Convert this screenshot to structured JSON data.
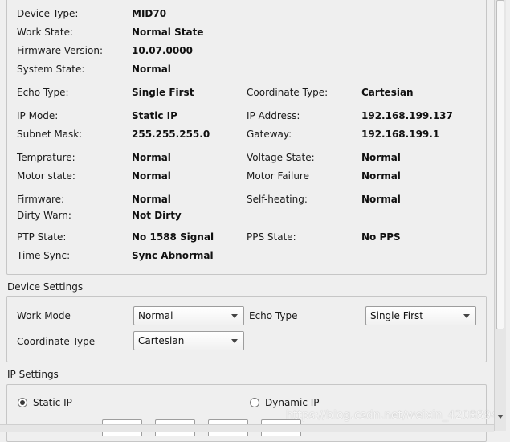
{
  "status": {
    "device_type": {
      "label": "Device Type:",
      "value": "MID70"
    },
    "work_state": {
      "label": "Work State:",
      "value": "Normal State"
    },
    "firmware_version": {
      "label": "Firmware Version:",
      "value": "10.07.0000"
    },
    "system_state": {
      "label": "System State:",
      "value": "Normal"
    },
    "echo_type": {
      "label": "Echo Type:",
      "value": "Single First"
    },
    "coordinate_type": {
      "label": "Coordinate Type:",
      "value": "Cartesian"
    },
    "ip_mode": {
      "label": "IP Mode:",
      "value": "Static IP"
    },
    "ip_address": {
      "label": "IP Address:",
      "value": "192.168.199.137"
    },
    "subnet_mask": {
      "label": "Subnet Mask:",
      "value": "255.255.255.0"
    },
    "gateway": {
      "label": "Gateway:",
      "value": "192.168.199.1"
    },
    "temperature": {
      "label": "Temprature:",
      "value": "Normal"
    },
    "voltage_state": {
      "label": "Voltage State:",
      "value": "Normal"
    },
    "motor_state": {
      "label": "Motor state:",
      "value": "Normal"
    },
    "motor_failure": {
      "label": "Motor Failure",
      "value": "Normal"
    },
    "firmware": {
      "label": "Firmware:",
      "value": "Normal"
    },
    "self_heating": {
      "label": "Self-heating:",
      "value": "Normal"
    },
    "dirty_warn": {
      "label": "Dirty Warn:",
      "value": "Not Dirty"
    },
    "ptp_state": {
      "label": "PTP State:",
      "value": "No 1588 Signal"
    },
    "pps_state": {
      "label": "PPS State:",
      "value": "No PPS"
    },
    "time_sync": {
      "label": "Time Sync:",
      "value": "Sync Abnormal"
    }
  },
  "device_settings": {
    "title": "Device Settings",
    "work_mode": {
      "label": "Work Mode",
      "selected": "Normal"
    },
    "echo_type": {
      "label": "Echo Type",
      "selected": "Single First"
    },
    "coordinate_type": {
      "label": "Coordinate Type",
      "selected": "Cartesian"
    }
  },
  "ip_settings": {
    "title": "IP Settings",
    "static_ip": {
      "label": "Static IP",
      "checked": true
    },
    "dynamic_ip": {
      "label": "Dynamic IP",
      "checked": false
    }
  },
  "watermark": "https://blog.csdn.net/weixin_42088940",
  "icons": [
    "chevron-down-icon",
    "radio-icon",
    "scroll-arrow-icon"
  ]
}
